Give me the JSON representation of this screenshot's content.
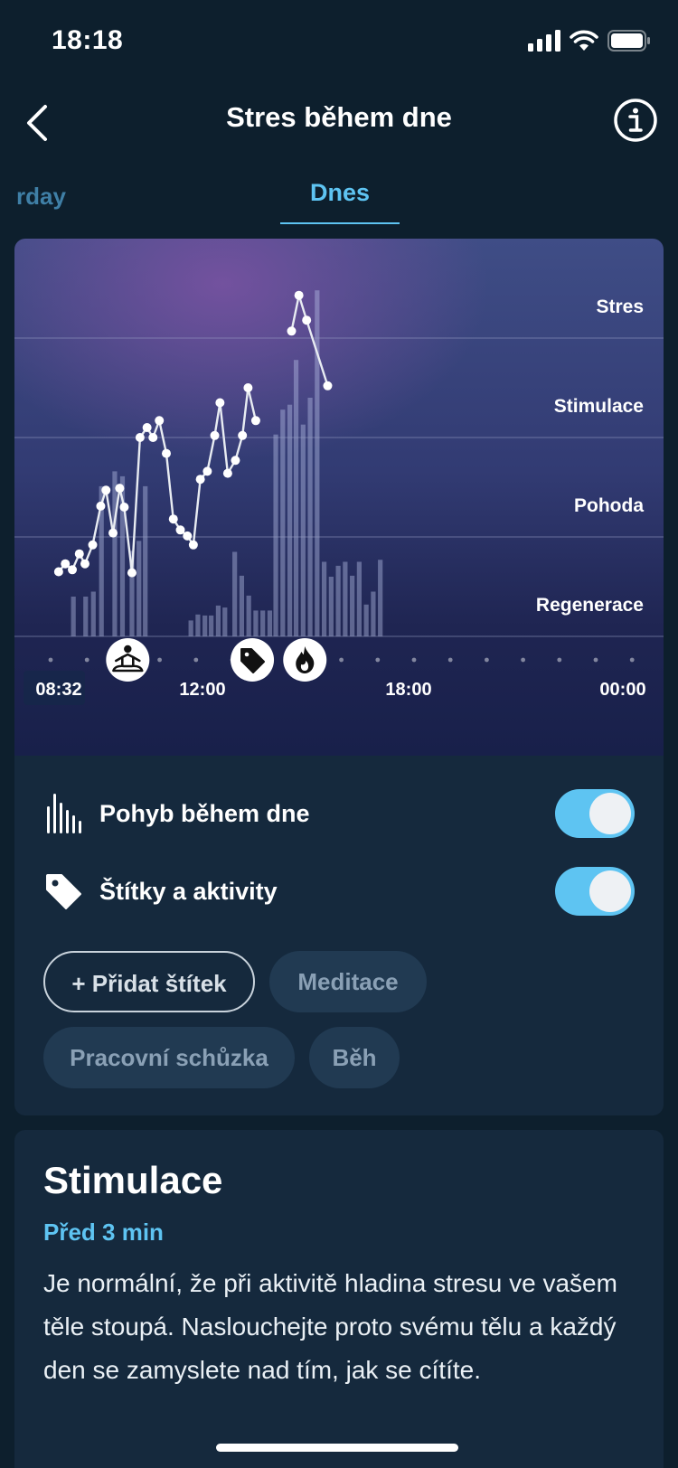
{
  "status_bar": {
    "time": "18:18"
  },
  "nav": {
    "title": "Stres během dne"
  },
  "tabs": {
    "previous": "rday",
    "active": "Dnes"
  },
  "chart_data": {
    "type": "line",
    "zones": [
      "Stres",
      "Stimulace",
      "Pohoda",
      "Regenerace"
    ],
    "x_ticks": [
      "08:32",
      "12:00",
      "18:00",
      "00:00"
    ],
    "stress_level": [
      [
        8.53,
        0.65
      ],
      [
        8.72,
        0.73
      ],
      [
        8.92,
        0.67
      ],
      [
        9.12,
        0.83
      ],
      [
        9.28,
        0.73
      ],
      [
        9.5,
        0.92
      ],
      [
        9.73,
        1.31
      ],
      [
        9.88,
        1.47
      ],
      [
        10.08,
        1.04
      ],
      [
        10.27,
        1.49
      ],
      [
        10.4,
        1.3
      ],
      [
        10.62,
        0.64
      ],
      [
        10.85,
        2.0
      ],
      [
        11.05,
        2.1
      ],
      [
        11.22,
        2.0
      ],
      [
        11.4,
        2.17
      ],
      [
        11.6,
        1.84
      ],
      [
        11.8,
        1.18
      ],
      [
        12.0,
        1.07
      ],
      [
        12.2,
        1.01
      ],
      [
        12.37,
        0.92
      ],
      [
        12.57,
        1.58
      ],
      [
        12.77,
        1.66
      ],
      [
        12.98,
        2.02
      ],
      [
        13.13,
        2.35
      ],
      [
        13.35,
        1.64
      ],
      [
        13.57,
        1.77
      ],
      [
        13.77,
        2.02
      ],
      [
        13.93,
        2.5
      ],
      [
        14.15,
        2.17
      ],
      [
        15.17,
        3.07
      ],
      [
        15.38,
        3.43
      ],
      [
        15.6,
        3.18
      ],
      [
        16.2,
        2.52
      ]
    ],
    "movement": [
      [
        8.95,
        0.4
      ],
      [
        9.3,
        0.4
      ],
      [
        9.52,
        0.45
      ],
      [
        9.75,
        1.51
      ],
      [
        10.13,
        1.66
      ],
      [
        10.35,
        1.61
      ],
      [
        10.62,
        0.86
      ],
      [
        10.82,
        0.96
      ],
      [
        11.0,
        1.51
      ],
      [
        12.3,
        0.16
      ],
      [
        12.5,
        0.22
      ],
      [
        12.7,
        0.21
      ],
      [
        12.88,
        0.21
      ],
      [
        13.08,
        0.31
      ],
      [
        13.27,
        0.29
      ],
      [
        13.55,
        0.85
      ],
      [
        13.75,
        0.61
      ],
      [
        13.95,
        0.41
      ],
      [
        14.15,
        0.26
      ],
      [
        14.35,
        0.26
      ],
      [
        14.55,
        0.26
      ],
      [
        14.72,
        2.03
      ],
      [
        14.92,
        2.28
      ],
      [
        15.12,
        2.33
      ],
      [
        15.3,
        2.78
      ],
      [
        15.5,
        2.13
      ],
      [
        15.7,
        2.4
      ],
      [
        15.9,
        3.48
      ],
      [
        16.1,
        0.75
      ],
      [
        16.3,
        0.6
      ],
      [
        16.5,
        0.71
      ],
      [
        16.7,
        0.75
      ],
      [
        16.9,
        0.61
      ],
      [
        17.1,
        0.75
      ],
      [
        17.3,
        0.32
      ],
      [
        17.5,
        0.45
      ],
      [
        17.7,
        0.77
      ]
    ],
    "markers": [
      {
        "time": 10.5,
        "icon": "meditation-icon"
      },
      {
        "time": 14.05,
        "icon": "tag-icon"
      },
      {
        "time": 15.55,
        "icon": "flame-icon"
      }
    ],
    "colors": {
      "line": "#e8ecf2",
      "bars": "#b8c2e6",
      "grid": "#9aa3c7"
    }
  },
  "toggles": [
    {
      "label": "Pohyb během dne",
      "icon": "movement-bars-icon",
      "on": true
    },
    {
      "label": "Štítky a aktivity",
      "icon": "tag-icon",
      "on": true
    }
  ],
  "chips": {
    "add": "+ Přidat štítek",
    "meditation": "Meditace",
    "meeting": "Pracovní schůzka",
    "run": "Běh"
  },
  "info": {
    "title": "Stimulace",
    "time": "Před 3 min",
    "body": "Je normální, že při aktivitě hladina stresu ve vašem těle stoupá. Naslouchejte proto svému tělu a každý den se zamyslete nad tím, jak se cítíte."
  },
  "colors": {
    "accent": "#5ec4f2",
    "background": "#0d1f2d",
    "card": "#15293d"
  }
}
